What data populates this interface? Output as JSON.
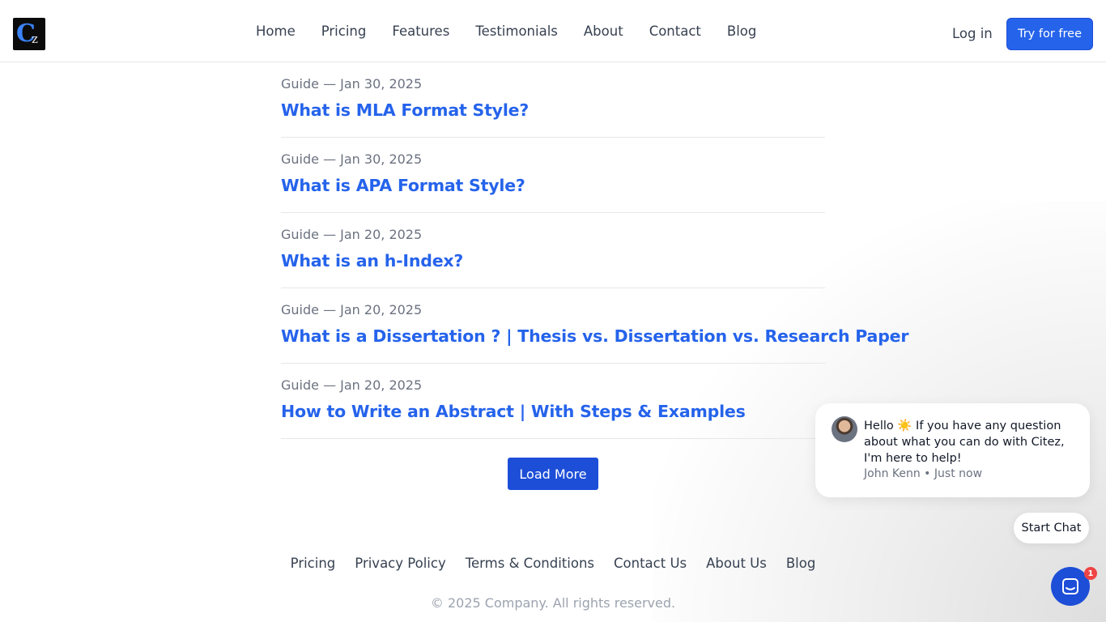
{
  "header": {
    "logo_text_c": "C",
    "logo_text_z": "z",
    "nav": [
      "Home",
      "Pricing",
      "Features",
      "Testimonials",
      "About",
      "Contact",
      "Blog"
    ],
    "login_label": "Log in",
    "try_label": "Try for free"
  },
  "articles": [
    {
      "meta": "Guide — Jan 30, 2025",
      "title": "What is MLA Format Style?"
    },
    {
      "meta": "Guide — Jan 30, 2025",
      "title": "What is APA Format Style?"
    },
    {
      "meta": "Guide — Jan 20, 2025",
      "title": "What is an h-Index?"
    },
    {
      "meta": "Guide — Jan 20, 2025",
      "title": "What is a Dissertation ? | Thesis vs. Dissertation vs. Research Paper"
    },
    {
      "meta": "Guide — Jan 20, 2025",
      "title": "How to Write an Abstract | With Steps & Examples"
    }
  ],
  "load_more_label": "Load More",
  "footer": {
    "links": [
      "Pricing",
      "Privacy Policy",
      "Terms & Conditions",
      "Contact Us",
      "About Us",
      "Blog"
    ],
    "copyright": "© 2025 Company. All rights reserved."
  },
  "chat": {
    "greeting": "Hello",
    "emoji": "☀️",
    "message": "If you have any question about what you can do with Citez, I'm here to help!",
    "author_meta": "John Kenn • Just now",
    "start_chat_label": "Start Chat",
    "unread_count": "1"
  },
  "colors": {
    "accent": "#2563eb",
    "button_dark": "#1d4ed8",
    "badge": "#ef4444"
  }
}
